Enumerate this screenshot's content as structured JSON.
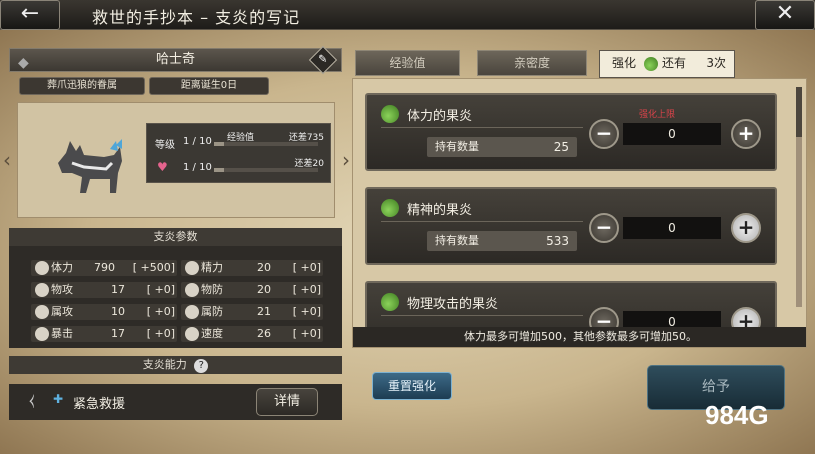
{
  "header": {
    "title": "救世的手抄本 – 支炎的写记",
    "back_icon": "←",
    "close_icon": "✕"
  },
  "companion": {
    "name": "哈士奇",
    "tag_breed": "葬爪迅狼的眷属",
    "tag_birth": "距离诞生0日",
    "level_label": "等级",
    "level_value": "1 / 10",
    "exp_label": "经验值",
    "exp_remaining": "还差735",
    "affection_value": "1 / 10",
    "affection_remaining": "还差20",
    "exp_progress": 0.1,
    "affection_progress": 0.1
  },
  "params_title": "支炎参数",
  "params": [
    {
      "label": "体力",
      "value": "790",
      "bonus": "[ +500]"
    },
    {
      "label": "精力",
      "value": "20",
      "bonus": "[  +0]"
    },
    {
      "label": "物攻",
      "value": "17",
      "bonus": "[  +0]"
    },
    {
      "label": "物防",
      "value": "20",
      "bonus": "[  +0]"
    },
    {
      "label": "属攻",
      "value": "10",
      "bonus": "[  +0]"
    },
    {
      "label": "属防",
      "value": "21",
      "bonus": "[  +0]"
    },
    {
      "label": "暴击",
      "value": "17",
      "bonus": "[  +0]"
    },
    {
      "label": "速度",
      "value": "26",
      "bonus": "[  +0]"
    }
  ],
  "ability_title": "支炎能力",
  "ability_help": "?",
  "ability_name": "紧急救援",
  "detail_label": "详情",
  "tabs": {
    "exp": "经验值",
    "affection": "亲密度",
    "enhance": "强化",
    "remaining": "还有",
    "count": "3次"
  },
  "items": [
    {
      "name": "体力的果炎",
      "own_label": "持有数量",
      "own_value": "25",
      "qty": "0",
      "limit": "强化上限"
    },
    {
      "name": "精神的果炎",
      "own_label": "持有数量",
      "own_value": "533",
      "qty": "0"
    },
    {
      "name": "物理攻击的果炎",
      "own_label": "持有数量",
      "own_value": "",
      "qty": "0"
    }
  ],
  "note": "体力最多可增加500，其他参数最多可增加50。",
  "reset_label": "重置强化",
  "give_label": "给予",
  "currency": "984G",
  "colors": {
    "accent_blue": "#3d6a87",
    "limit_red": "#d9434a"
  }
}
